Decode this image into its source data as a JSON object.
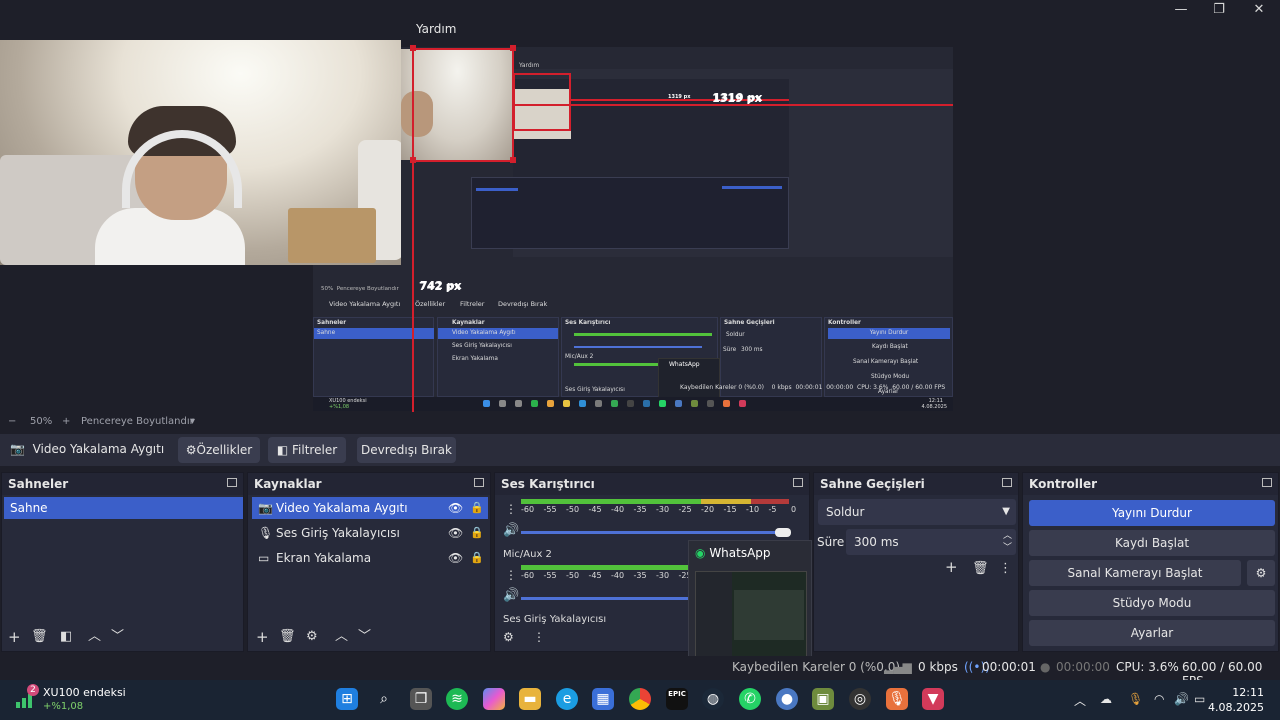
{
  "window": {
    "menu_visible": "Yardım",
    "controls": [
      "minimize-icon",
      "restore-icon",
      "close-icon"
    ]
  },
  "preview": {
    "measure_horizontal": "1319 px",
    "measure_vertical": "742 px",
    "nested": {
      "menu": "Yardım",
      "measure_horizontal": "1319 px",
      "measure_vertical_small": "742 px",
      "zoom": "50%",
      "fit_label": "Pencereye Boyutlandır",
      "source_name": "Video Yakalama Aygıtı",
      "props": "Özellikler",
      "filters": "Filtreler",
      "deactivate": "Devredışı Bırak",
      "scenes_title": "Sahneler",
      "scene": "Sahne",
      "sources_title": "Kaynaklar",
      "sources": [
        "Video Yakalama Aygıtı",
        "Ses Giriş Yakalayıcısı",
        "Ekran Yakalama"
      ],
      "mixer_title": "Ses Karıştırıcı",
      "mixer_ch2": "Mic/Aux 2",
      "mixer_ch3": "Ses Giriş Yakalayıcısı",
      "transitions_title": "Sahne Geçişleri",
      "transition": "Soldur",
      "duration_label": "Süre",
      "duration": "300 ms",
      "controls_title": "Kontroller",
      "controls": [
        "Yayını Durdur",
        "Kaydı Başlat",
        "Sanal Kamerayı Başlat",
        "Stüdyo Modu",
        "Ayarlar"
      ],
      "whatsapp": "WhatsApp",
      "status": "Kaybedilen Kareler 0 (%0.0)",
      "kbps": "0 kbps",
      "time1": "00:00:01",
      "time2": "00:00:00",
      "cpu": "CPU: 3.6%",
      "fps": "60.00 / 60.00 FPS",
      "widget_name": "XU100 endeksi",
      "widget_change": "+%1,08",
      "clock_time": "12:11",
      "clock_date": "4.08.2025"
    }
  },
  "zoombar": {
    "minus": "−",
    "zoom": "50%",
    "plus": "+",
    "fit": "Pencereye Boyutlandır",
    "dropdown": "▾"
  },
  "source_toolbar": {
    "source_name": "Video Yakalama Aygıtı",
    "properties": "Özellikler",
    "filters": "Filtreler",
    "deactivate": "Devredışı Bırak"
  },
  "scenes": {
    "title": "Sahneler",
    "items": [
      "Sahne"
    ]
  },
  "sources": {
    "title": "Kaynaklar",
    "items": [
      {
        "label": "Video Yakalama Aygıtı",
        "icon": "camera-icon",
        "selected": true
      },
      {
        "label": "Ses Giriş Yakalayıcısı",
        "icon": "microphone-icon",
        "selected": false
      },
      {
        "label": "Ekran Yakalama",
        "icon": "monitor-icon",
        "selected": false
      }
    ]
  },
  "mixer": {
    "title": "Ses Karıştırıcı",
    "scale": [
      "-60",
      "-55",
      "-50",
      "-45",
      "-40",
      "-35",
      "-30",
      "-25",
      "-20",
      "-15",
      "-10",
      "-5",
      "0"
    ],
    "channel2": "Mic/Aux 2",
    "channel3": "Ses Giriş Yakalayıcısı"
  },
  "transitions": {
    "title": "Sahne Geçişleri",
    "selected": "Soldur",
    "duration_label": "Süre",
    "duration": "300 ms"
  },
  "controls": {
    "title": "Kontroller",
    "stop_stream": "Yayını Durdur",
    "start_record": "Kaydı Başlat",
    "start_virtual_cam": "Sanal Kamerayı Başlat",
    "studio_mode": "Stüdyo Modu",
    "settings": "Ayarlar"
  },
  "whatsapp_popup": {
    "title": "WhatsApp"
  },
  "status": {
    "dropped": "Kaybedilen Kareler 0 (%0.0)",
    "kbps": "0 kbps",
    "stream_time": "00:00:01",
    "record_time": "00:00:00",
    "cpu": "CPU: 3.6%",
    "fps": "60.00 / 60.00 FPS"
  },
  "taskbar": {
    "widget_badge": "2",
    "widget_name": "XU100 endeksi",
    "widget_change": "+%1,08",
    "clock_time": "12:11",
    "clock_date": "4.08.2025",
    "epic_label": "EPIC"
  },
  "colors": {
    "accent": "#3b5fc9",
    "panel": "#272a3a",
    "background": "#1e1f29",
    "measure_red": "#d31f2c",
    "meter_green": "#52c23b",
    "meter_yellow": "#d5b532",
    "meter_red": "#b43a3a"
  }
}
